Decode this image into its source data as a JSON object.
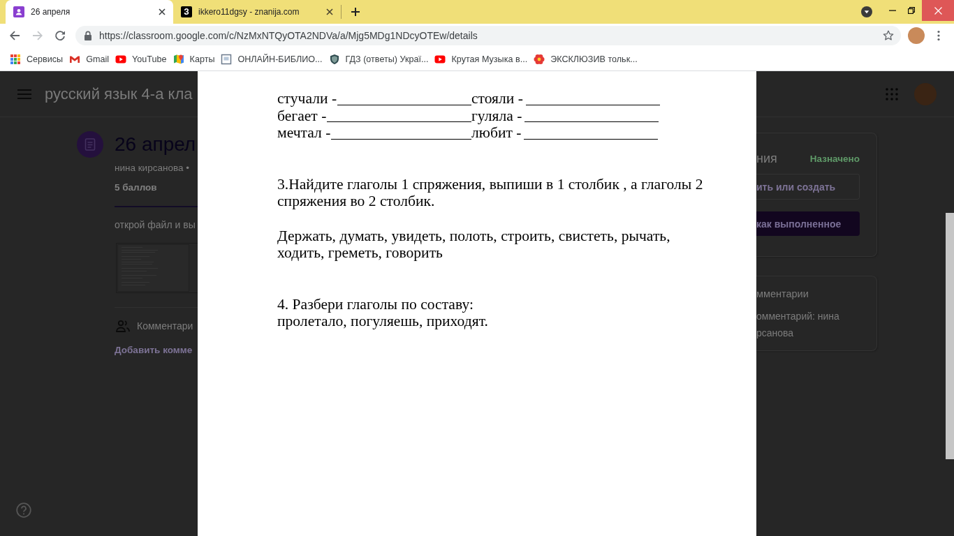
{
  "browser": {
    "tabs": [
      {
        "kind": "classroom",
        "title": "26 апреля",
        "selected": true
      },
      {
        "kind": "letter",
        "glyph": "З",
        "title": "ikkero11dgsy - znanija.com",
        "selected": false
      }
    ],
    "nav": [
      {
        "kind": "back",
        "disabled": false
      },
      {
        "kind": "forward",
        "disabled": true
      },
      {
        "kind": "reload",
        "disabled": false
      }
    ],
    "url": "https://classroom.google.com/c/NzMxNTQyOTA2NDVa/a/Mjg5MDg1NDcyOTEw/details",
    "bookmarks": [
      {
        "kind": "apps",
        "label": "Сервисы"
      },
      {
        "kind": "gmail",
        "label": "Gmail"
      },
      {
        "kind": "youtube",
        "label": "YouTube"
      },
      {
        "kind": "maps",
        "label": "Карты"
      },
      {
        "kind": "page",
        "label": "ОНЛАЙН-БИБЛИО..."
      },
      {
        "kind": "shield",
        "label": "ГДЗ (ответы) Украї..."
      },
      {
        "kind": "youtube",
        "label": "Крутая Музыка в..."
      },
      {
        "kind": "flower",
        "label": "ЭКСКЛЮЗИВ тольк..."
      }
    ]
  },
  "classroom": {
    "course_title": "русский язык 4-а кла",
    "assignment": {
      "title": "26 апрел",
      "author": "нина кирсанова •",
      "points": "5 баллов",
      "instructions": "открой файл и вы",
      "comments_heading": "Комментари",
      "add_comment": "Добавить комме"
    },
    "work_card": {
      "heading": "ния",
      "status": "Назначено",
      "add_button": "ить или создать",
      "done_button": "как выполненное"
    },
    "private_comments": {
      "heading": "мментарии",
      "add_comment_lines": [
        "омментарий: нина",
        "рсанова"
      ]
    }
  },
  "document": {
    "blank_rows": [
      {
        "items": [
          "стучали -",
          "стояли -"
        ]
      },
      {
        "items": [
          "бегает -",
          "гуляла -"
        ]
      },
      {
        "items": [
          "мечтал -",
          "любит -"
        ]
      }
    ],
    "paragraphs": [
      "3.Найдите глаголы 1 спряжения, выпиши в 1 столбик , а глаголы 2 спряжения во 2 столбик.",
      "Держать, думать, увидеть, полоть, строить, свистеть, рычать, ходить, греметь, говорить",
      "4. Разбери глаголы по составу:",
      "пролетало, погуляешь, приходят."
    ]
  }
}
